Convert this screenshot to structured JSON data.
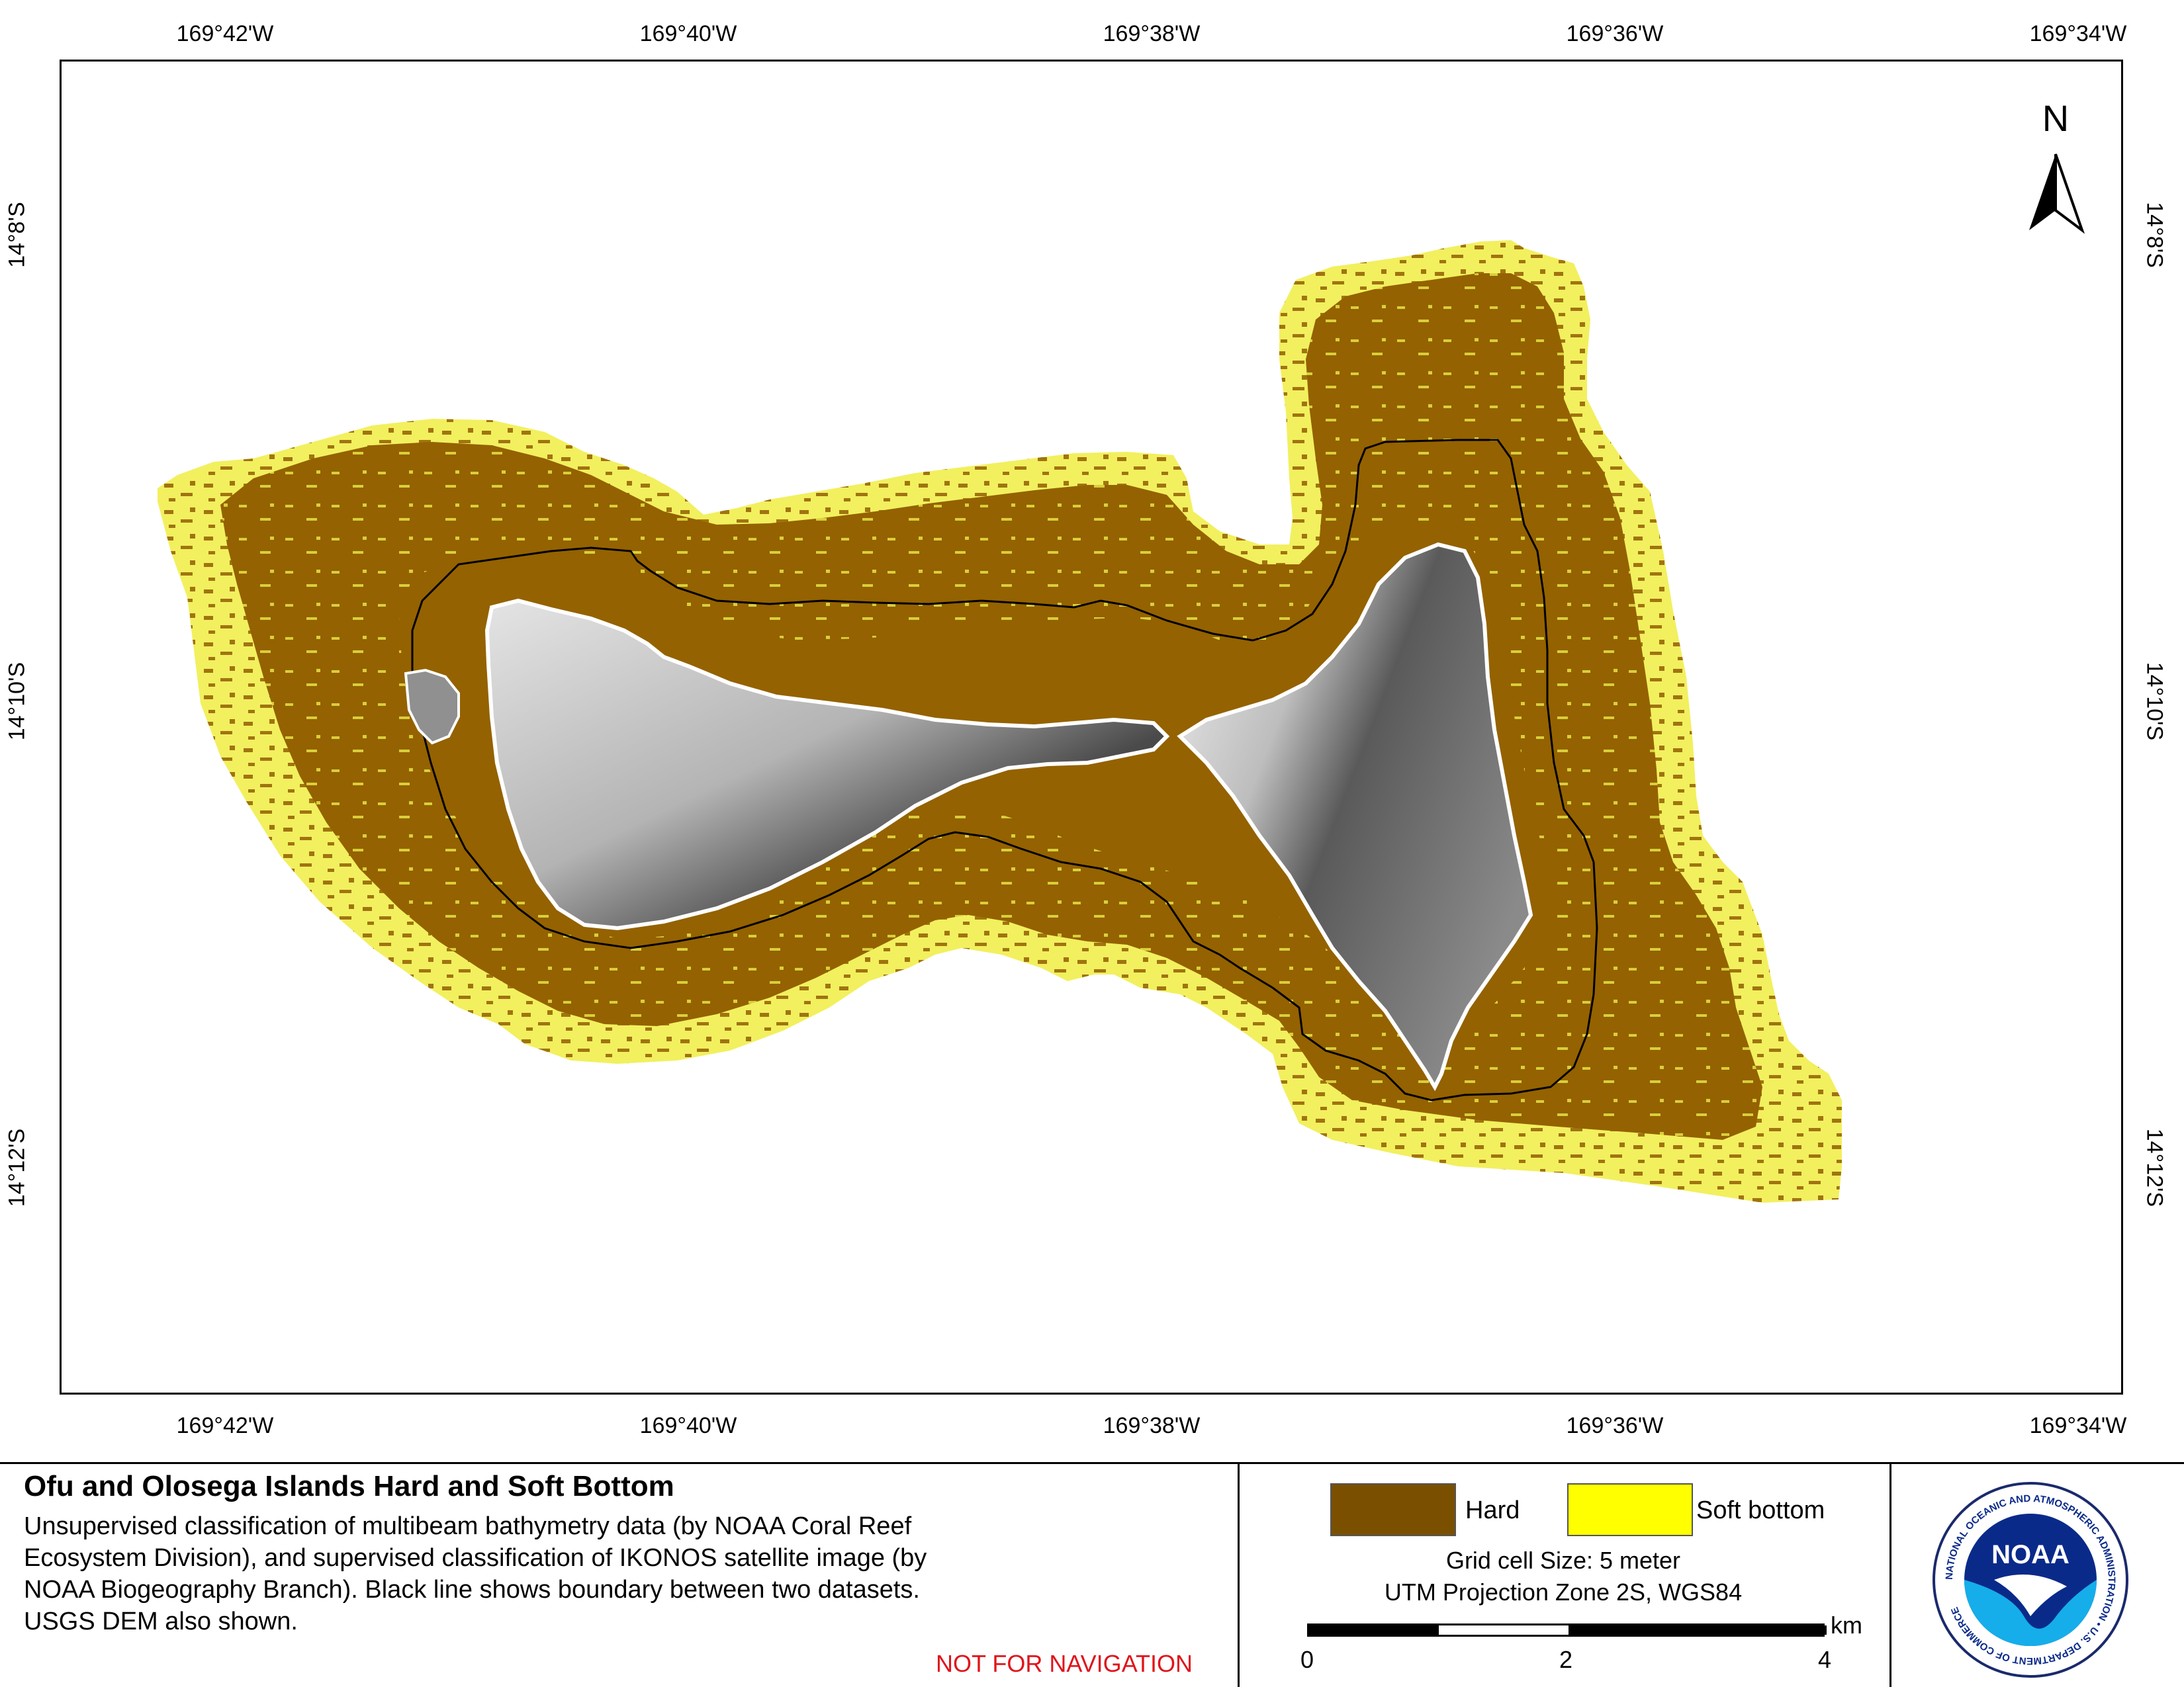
{
  "map": {
    "top_ticks": [
      "169°42'W",
      "169°40'W",
      "169°38'W",
      "169°36'W",
      "169°34'W"
    ],
    "bottom_ticks": [
      "169°42'W",
      "169°40'W",
      "169°38'W",
      "169°36'W",
      "169°34'W"
    ],
    "left_ticks": [
      "14°8'S",
      "14°10'S",
      "14°12'S"
    ],
    "right_ticks": [
      "14°8'S",
      "14°10'S",
      "14°12'S"
    ],
    "north_arrow_label": "N"
  },
  "legend": {
    "title": "Ofu and Olosega Islands Hard and Soft Bottom",
    "description_lines": [
      "Unsupervised classification of multibeam bathymetry data (by NOAA Coral Reef",
      "Ecosystem Division), and supervised classification of IKONOS satellite image (by",
      "NOAA Biogeography Branch). Black line shows boundary between two datasets.",
      "USGS DEM also shown."
    ],
    "not_for_navigation": "NOT FOR NAVIGATION",
    "classes": [
      {
        "label": "Hard",
        "color": "#7a5000"
      },
      {
        "label": "Soft bottom",
        "color": "#ffff00"
      }
    ],
    "grid_cell": "Grid cell Size: 5 meter",
    "projection": "UTM Projection Zone 2S, WGS84",
    "scale_labels": [
      "0",
      "2",
      "4"
    ],
    "scale_unit": "km"
  },
  "logo": {
    "center_text": "NOAA",
    "ring_text": "NATIONAL OCEANIC AND ATMOSPHERIC ADMINISTRATION • U.S. DEPARTMENT OF COMMERCE"
  },
  "colors": {
    "hard": "#946200",
    "soft": "#f4f264",
    "land_light": "#d8d8d8",
    "land_dark": "#3a3a3a",
    "boundary": "#000000",
    "warning": "#e0141b"
  }
}
